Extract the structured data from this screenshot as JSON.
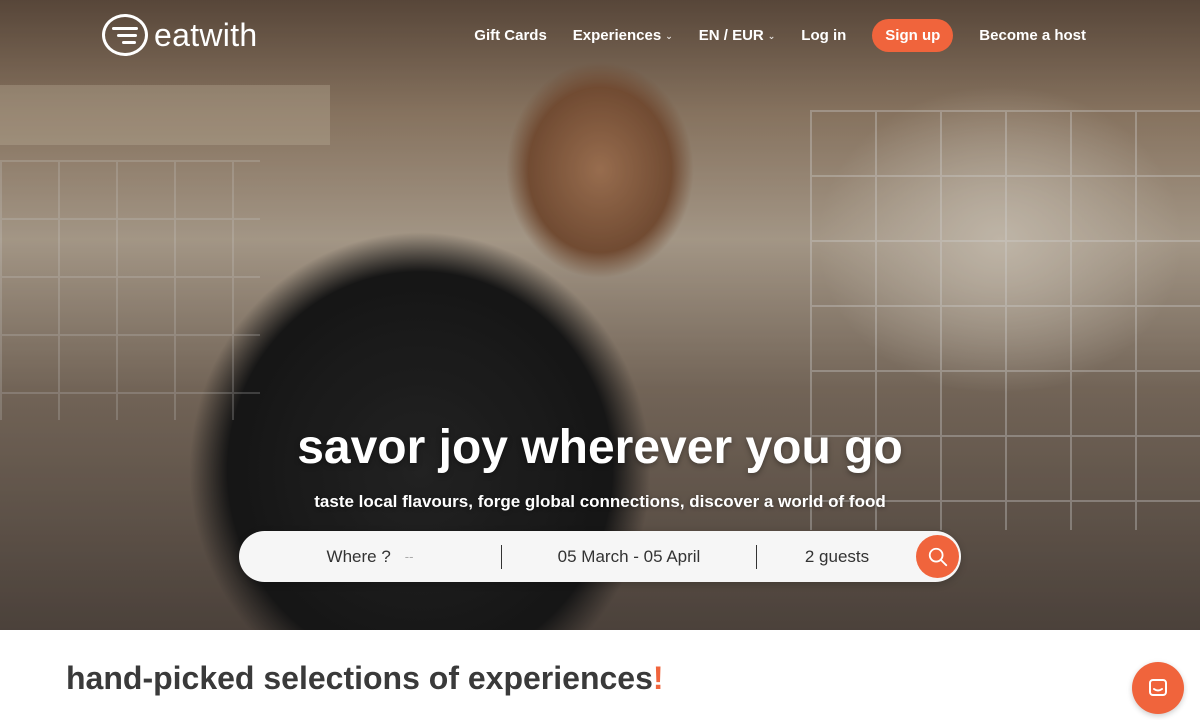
{
  "header": {
    "logo_text": "eatwith",
    "nav": {
      "gift_cards": "Gift Cards",
      "experiences": "Experiences",
      "language_currency": "EN / EUR",
      "login": "Log in",
      "signup": "Sign up",
      "become_host": "Become a host"
    }
  },
  "hero": {
    "headline": "savor joy wherever you go",
    "subheadline": "taste local flavours, forge global connections, discover a world of food"
  },
  "search": {
    "where_label": "Where ?",
    "where_value": "--",
    "dates": "05 March - 05 April",
    "guests": "2 guests"
  },
  "section": {
    "title": "hand-picked selections of experiences",
    "title_accent": "!"
  },
  "colors": {
    "accent": "#f0643c",
    "text_dark": "#3a3a3a"
  },
  "icons": [
    "search-icon",
    "chat-icon",
    "chevron-down-icon",
    "eatwith-logo-icon"
  ]
}
